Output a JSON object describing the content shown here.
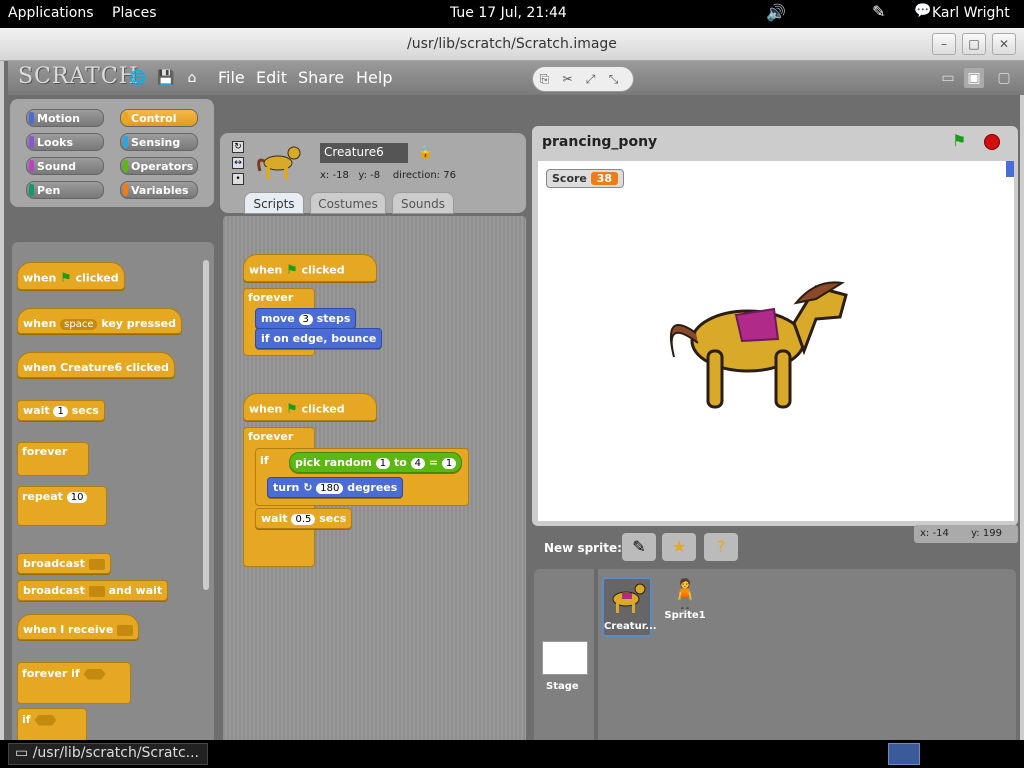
{
  "topbar": {
    "applications": "Applications",
    "places": "Places",
    "clock": "Tue 17 Jul, 21:44",
    "user": "Karl Wright"
  },
  "window": {
    "title": "/usr/lib/scratch/Scratch.image"
  },
  "menu": {
    "logo": "SCRATCH",
    "file": "File",
    "edit": "Edit",
    "share": "Share",
    "help": "Help"
  },
  "categories": [
    {
      "label": "Motion",
      "color": "#4a6cd4"
    },
    {
      "label": "Control",
      "color": "#e6a822",
      "selected": true
    },
    {
      "label": "Looks",
      "color": "#8a55d7"
    },
    {
      "label": "Sensing",
      "color": "#2ca5e2"
    },
    {
      "label": "Sound",
      "color": "#bb42c3"
    },
    {
      "label": "Operators",
      "color": "#5cb712"
    },
    {
      "label": "Pen",
      "color": "#0e9a6c"
    },
    {
      "label": "Variables",
      "color": "#ee7d16"
    }
  ],
  "sprite_info": {
    "name": "Creature6",
    "x_label": "x:",
    "x": "-18",
    "y_label": "y:",
    "y": "-8",
    "direction_label": "direction:",
    "direction": "76"
  },
  "tabs": {
    "scripts": "Scripts",
    "costumes": "Costumes",
    "sounds": "Sounds"
  },
  "palette": {
    "when": "when",
    "clicked": "clicked",
    "key_pressed": "key pressed",
    "space": "space",
    "when_creature_clicked": "when Creature6 clicked",
    "wait": "wait",
    "secs": "secs",
    "wait_val": "1",
    "forever": "forever",
    "repeat": "repeat",
    "repeat_val": "10",
    "broadcast": "broadcast",
    "and_wait": "and wait",
    "when_i_receive": "when I receive",
    "forever_if": "forever if",
    "if": "if"
  },
  "script1": {
    "when": "when",
    "clicked": "clicked",
    "forever": "forever",
    "move": "move",
    "move_val": "3",
    "steps": "steps",
    "bounce": "if on edge, bounce"
  },
  "script2": {
    "when": "when",
    "clicked": "clicked",
    "forever": "forever",
    "if": "if",
    "pick_random": "pick random",
    "r1": "1",
    "to": "to",
    "r2": "4",
    "eq": "=",
    "eq_val": "1",
    "turn": "turn",
    "turn_val": "180",
    "degrees": "degrees",
    "wait": "wait",
    "wait_val": "0.5",
    "secs": "secs"
  },
  "stage": {
    "project_name": "prancing_pony",
    "score_label": "Score",
    "score_value": "38",
    "mouse_x_label": "x:",
    "mouse_x": "-14",
    "mouse_y_label": "y:",
    "mouse_y": "199"
  },
  "sprites": {
    "new_sprite": "New sprite:",
    "stage_label": "Stage",
    "items": [
      {
        "name": "Creatur..."
      },
      {
        "name": "Sprite1"
      }
    ]
  },
  "taskbar": {
    "task": "/usr/lib/scratch/Scratc..."
  }
}
